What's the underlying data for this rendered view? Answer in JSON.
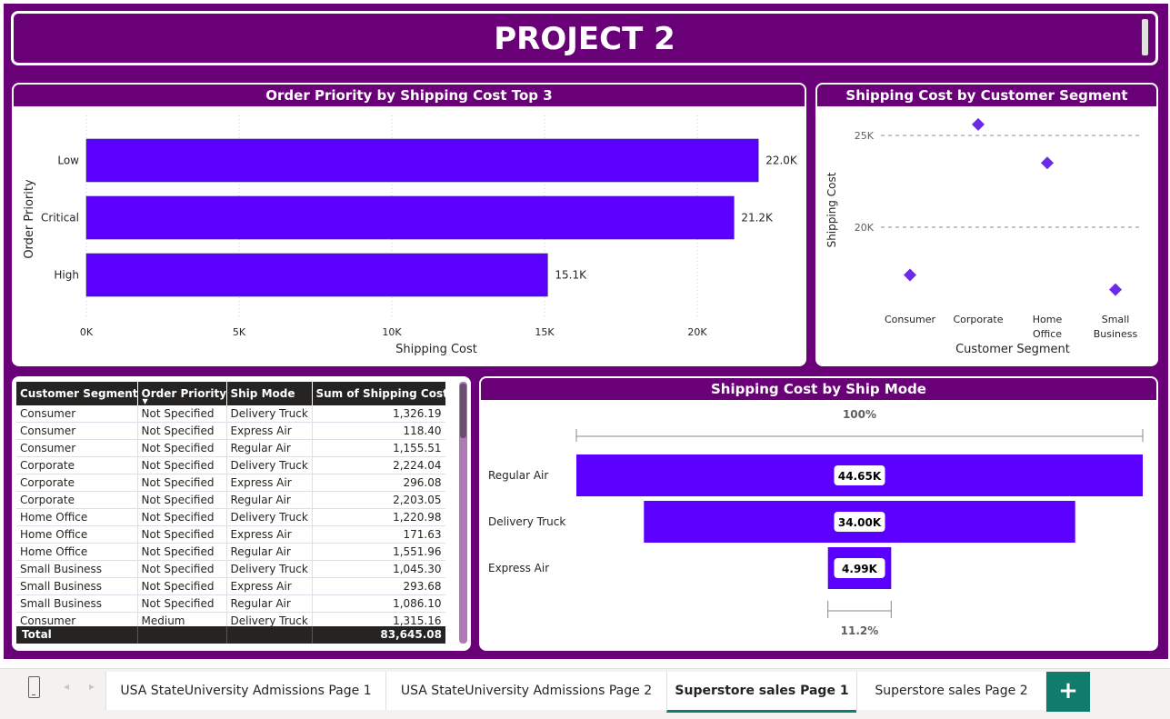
{
  "title": "PROJECT 2",
  "charts": {
    "priority": {
      "title": "Order Priority by Shipping Cost Top 3",
      "xlabel": "Shipping Cost",
      "ylabel": "Order Priority"
    },
    "segment": {
      "title": "Shipping Cost by Customer Segment",
      "xlabel": "Customer Segment",
      "ylabel": "Shipping Cost"
    },
    "shipmode": {
      "title": "Shipping Cost by Ship Mode",
      "top_pct": "100%",
      "bottom_pct": "11.2%"
    }
  },
  "chart_data": [
    {
      "type": "bar",
      "orientation": "horizontal",
      "categories": [
        "Low",
        "Critical",
        "High"
      ],
      "values": [
        22000,
        21200,
        15100
      ],
      "data_labels": [
        "22.0K",
        "21.2K",
        "15.1K"
      ],
      "title": "Order Priority by Shipping Cost Top 3",
      "xlabel": "Shipping Cost",
      "ylabel": "Order Priority",
      "xlim": [
        0,
        22000
      ],
      "xticks": [
        "0K",
        "5K",
        "10K",
        "15K",
        "20K"
      ],
      "color": "#5b00ff"
    },
    {
      "type": "scatter",
      "categories": [
        "Consumer",
        "Corporate",
        "Home Office",
        "Small Business"
      ],
      "category_labels": [
        [
          "Consumer"
        ],
        [
          "Corporate"
        ],
        [
          "Home",
          "Office"
        ],
        [
          "Small",
          "Business"
        ]
      ],
      "values": [
        17400,
        25600,
        23500,
        16600
      ],
      "title": "Shipping Cost by Customer Segment",
      "xlabel": "Customer Segment",
      "ylabel": "Shipping Cost",
      "ylim": [
        15500,
        26200
      ],
      "yticks": [
        "20K",
        "25K"
      ],
      "color": "#6a2ae8"
    },
    {
      "type": "bar",
      "subtype": "funnel",
      "categories": [
        "Regular Air",
        "Delivery Truck",
        "Express Air"
      ],
      "values": [
        44650,
        34000,
        4990
      ],
      "data_labels": [
        "44.65K",
        "34.00K",
        "4.99K"
      ],
      "title": "Shipping Cost by Ship Mode",
      "top_percent": "100%",
      "bottom_percent": "11.2%",
      "color": "#5b00ff"
    }
  ],
  "table": {
    "headers": [
      "Customer Segment",
      "Order Priority",
      "Ship Mode",
      "Sum of Shipping Cost"
    ],
    "rows": [
      [
        "Consumer",
        "Not Specified",
        "Delivery Truck",
        "1,326.19"
      ],
      [
        "Consumer",
        "Not Specified",
        "Express Air",
        "118.40"
      ],
      [
        "Consumer",
        "Not Specified",
        "Regular Air",
        "1,155.51"
      ],
      [
        "Corporate",
        "Not Specified",
        "Delivery Truck",
        "2,224.04"
      ],
      [
        "Corporate",
        "Not Specified",
        "Express Air",
        "296.08"
      ],
      [
        "Corporate",
        "Not Specified",
        "Regular Air",
        "2,203.05"
      ],
      [
        "Home Office",
        "Not Specified",
        "Delivery Truck",
        "1,220.98"
      ],
      [
        "Home Office",
        "Not Specified",
        "Express Air",
        "171.63"
      ],
      [
        "Home Office",
        "Not Specified",
        "Regular Air",
        "1,551.96"
      ],
      [
        "Small Business",
        "Not Specified",
        "Delivery Truck",
        "1,045.30"
      ],
      [
        "Small Business",
        "Not Specified",
        "Express Air",
        "293.68"
      ],
      [
        "Small Business",
        "Not Specified",
        "Regular Air",
        "1,086.10"
      ],
      [
        "Consumer",
        "Medium",
        "Delivery Truck",
        "1,315.16"
      ]
    ],
    "total_label": "Total",
    "total_value": "83,645.08"
  },
  "tabs": [
    {
      "label": "USA StateUniversity Admissions Page 1"
    },
    {
      "label": "USA StateUniversity Admissions Page 2"
    },
    {
      "label": "Superstore sales Page 1"
    },
    {
      "label": "Superstore sales Page 2"
    }
  ],
  "add_tab_label": "+",
  "colors": {
    "background": "#6a0078",
    "bar": "#5b00ff",
    "accent_tab": "#107c6b"
  }
}
